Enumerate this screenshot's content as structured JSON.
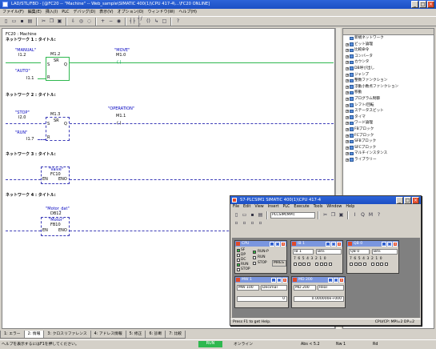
{
  "window": {
    "title": "LAD/STL/FBD - [@FC20 -- \"Machine\" -- Web_sample\\SIMATIC 400(1)\\CPU 417-4\\...\\FC20  ONLINE]",
    "min": "_",
    "max": "□",
    "close": "×"
  },
  "menu": [
    "ファイル(F)",
    "編集(E)",
    "挿入(I)",
    "PLC",
    "デバッグ(D)",
    "表示(V)",
    "オプション(O)",
    "ウィンドウ(W)",
    "ヘルプ(H)"
  ],
  "editor": {
    "block_title": "FC20 : Machine",
    "networks": [
      {
        "title": "ネットワーク 1 : タイトル:",
        "contact1_sym": "\"MANUAL\"",
        "contact1_addr": "I1.2",
        "contact2_sym": "\"AUTO\"",
        "contact2_addr": "I1.1",
        "box_addr": "M1.2",
        "box_type": "SR",
        "pin_s": "S",
        "pin_q": "Q",
        "pin_r": "R",
        "coil_sym": "\"MOVE\"",
        "coil_addr": "M1.0",
        "coil": "( )"
      },
      {
        "title": "ネットワーク 2 : タイトル:",
        "contact1_sym": "\"STOP\"",
        "contact1_addr": "I2.0",
        "contact2_sym": "\"RUN\"",
        "contact2_addr": "I1.7",
        "box_addr": "M1.3",
        "box_type": "SR",
        "pin_s": "S",
        "pin_q": "Q",
        "pin_r": "R",
        "coil_sym": "\"OPERATION\"",
        "coil_addr": "M1.1",
        "coil": "( )"
      },
      {
        "title": "ネットワーク 3 : タイトル:",
        "fc_sym": "\"Valve\"",
        "fc_addr": "FC10",
        "en": "EN",
        "eno": "ENO"
      },
      {
        "title": "ネットワーク 4 : タイトル:",
        "fb_db": "\"Motor_dat\"",
        "fb_dbaddr": "DB12",
        "fb_sym": "\"Motor\"",
        "fb_addr": "FB10",
        "en": "EN",
        "eno": "ENO"
      }
    ]
  },
  "catalog": {
    "items": [
      "新規ネットワーク",
      "ビット論理",
      "比較命令",
      "コンバータ",
      "カウンタ",
      "DB呼び出し",
      "ジャンプ",
      "整数ファンクション",
      "浮動小数点ファンクション",
      "移動",
      "プログラム制御",
      "シフト/回転",
      "ステータスビット",
      "タイマ",
      "ワード論理",
      "FBブロック",
      "FCブロック",
      "SFBブロック",
      "SFCブロック",
      "マルチインスタンス",
      "ライブラリー"
    ]
  },
  "tabs": [
    "1: エラー",
    "2: 情報",
    "3: クロスリファレンス",
    "4: アドレス情報",
    "5: 修正",
    "6: 診断",
    "7: 比較"
  ],
  "status": {
    "hint": "ヘルプを表示するにはF1を押してください。",
    "online": "RUN",
    "mode": "オンライン",
    "abs": "Abs < 5.2",
    "nw": "Nw 1",
    "rd": "Rd"
  },
  "sim": {
    "title": "S7-PLCSIM1     SIMATIC 400(1)\\CPU 417-4",
    "menu": [
      "File",
      "Edit",
      "View",
      "Insert",
      "PLC",
      "Execute",
      "Tools",
      "Window",
      "Help"
    ],
    "plc_select": "PLCSIM(MPI)",
    "status": "Press F1 to get Help.",
    "cpu_status": "CPU/CP:  MPI=2 DP=2",
    "cpu": {
      "title": "CPU",
      "flags": [
        "SF",
        "DP",
        "DC",
        "RUN",
        "STOP"
      ],
      "run_p": "RUN-P",
      "run": "RUN",
      "stop": "STOP",
      "mres": "MRES"
    },
    "ib1": {
      "title": "IB     1",
      "addr": "IB   1",
      "fmt": "Bits",
      "bits": "7 6 5 4   3 2 1 0"
    },
    "qb0": {
      "title": "QB     0",
      "addr": "QB   0",
      "fmt": "Bits",
      "bits": "7 6 5 4   3 2 1 0"
    },
    "mw": {
      "title": "MW    1",
      "addr": "MW  100",
      "fmt": "Decimal",
      "value": "0"
    },
    "md": {
      "title": "MD   200",
      "addr": "MD  200",
      "fmt": "Real",
      "value": "0.000000e+000"
    }
  }
}
